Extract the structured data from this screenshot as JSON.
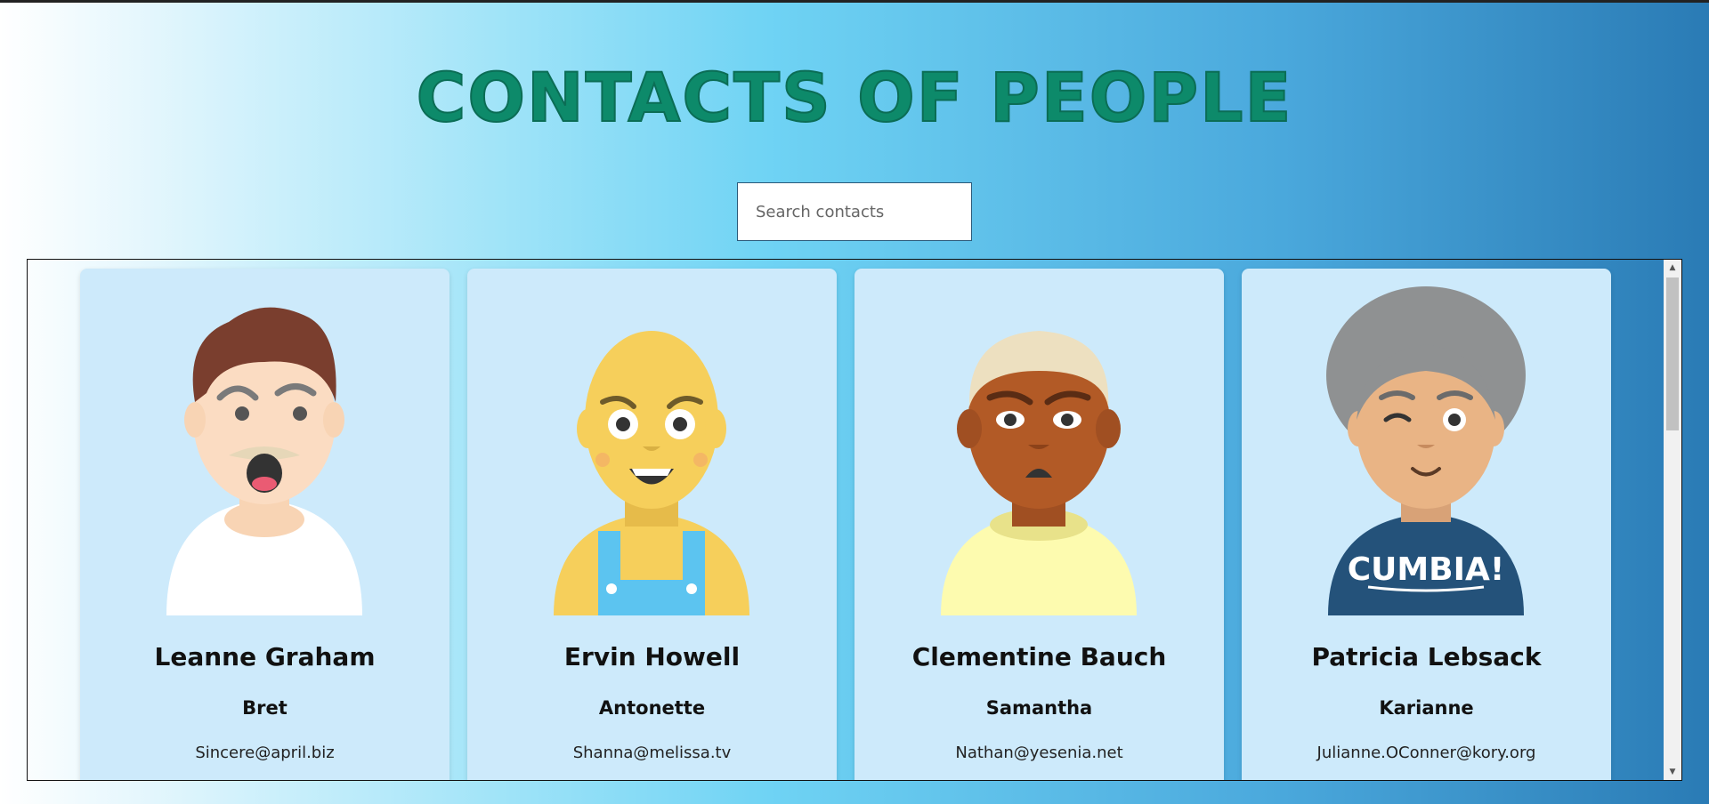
{
  "header": {
    "title": "CONTACTS OF PEOPLE"
  },
  "search": {
    "placeholder": "Search contacts",
    "value": ""
  },
  "contacts": [
    {
      "name": "Leanne Graham",
      "username": "Bret",
      "email": "Sincere@april.biz",
      "avatar": "man-brown-hair-mustache-avatar"
    },
    {
      "name": "Ervin Howell",
      "username": "Antonette",
      "email": "Shanna@melissa.tv",
      "avatar": "bald-yellow-overalls-avatar"
    },
    {
      "name": "Clementine Bauch",
      "username": "Samantha",
      "email": "Nathan@yesenia.net",
      "avatar": "dark-skin-blonde-hair-avatar"
    },
    {
      "name": "Patricia Lebsack",
      "username": "Karianne",
      "email": "Julianne.OConner@kory.org",
      "avatar": "grey-hair-cumbia-shirt-avatar"
    }
  ],
  "avatar_text": {
    "shirt_text": "CUMBIA!"
  },
  "colors": {
    "card_bg": "#cdeafb",
    "title": "#0d8a6a"
  }
}
